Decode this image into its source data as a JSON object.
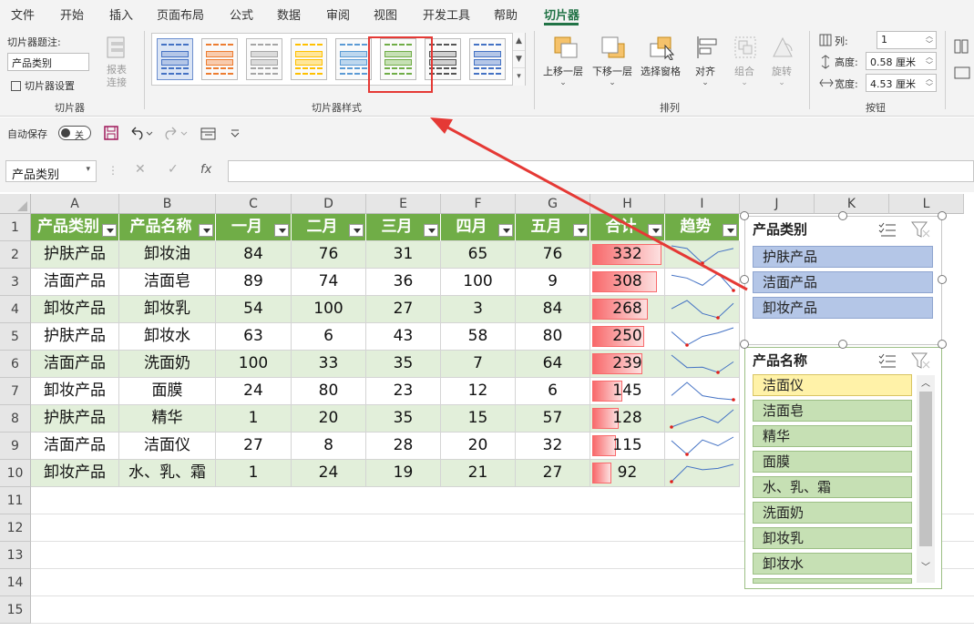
{
  "menu": [
    "文件",
    "开始",
    "插入",
    "页面布局",
    "公式",
    "数据",
    "审阅",
    "视图",
    "开发工具",
    "帮助",
    "切片器"
  ],
  "ribbon": {
    "caption_label": "切片器题注:",
    "caption_value": "产品类别",
    "settings_label": "切片器设置",
    "report_label": "报表",
    "connect_label": "连接",
    "group_slicer": "切片器",
    "group_styles": "切片器样式",
    "group_arrange": "排列",
    "group_buttons": "按钮",
    "bring_forward": "上移一层",
    "send_backward": "下移一层",
    "selection_pane": "选择窗格",
    "align": "对齐",
    "group": "组合",
    "rotate": "旋转",
    "columns_label": "列:",
    "columns_value": "1",
    "height_label": "高度:",
    "height_value": "0.58 厘米",
    "width_label": "宽度:",
    "width_value": "4.53 厘米"
  },
  "qat": {
    "autosave_label": "自动保存",
    "toggle_text": "关"
  },
  "formula_bar": {
    "name_box": "产品类别",
    "fx": "fx"
  },
  "columns": [
    "A",
    "B",
    "C",
    "D",
    "E",
    "F",
    "G",
    "H",
    "I",
    "J",
    "K",
    "L"
  ],
  "rows": [
    "1",
    "2",
    "3",
    "4",
    "5",
    "6",
    "7",
    "8",
    "9",
    "10",
    "11",
    "12",
    "13",
    "14",
    "15"
  ],
  "table": {
    "headers": [
      "产品类别",
      "产品名称",
      "一月",
      "二月",
      "三月",
      "四月",
      "五月",
      "合计",
      "趋势"
    ],
    "rows": [
      [
        "护肤产品",
        "卸妆油",
        "84",
        "76",
        "31",
        "65",
        "76",
        "332"
      ],
      [
        "洁面产品",
        "洁面皂",
        "89",
        "74",
        "36",
        "100",
        "9",
        "308"
      ],
      [
        "卸妆产品",
        "卸妆乳",
        "54",
        "100",
        "27",
        "3",
        "84",
        "268"
      ],
      [
        "护肤产品",
        "卸妆水",
        "63",
        "6",
        "43",
        "58",
        "80",
        "250"
      ],
      [
        "洁面产品",
        "洗面奶",
        "100",
        "33",
        "35",
        "7",
        "64",
        "239"
      ],
      [
        "卸妆产品",
        "面膜",
        "24",
        "80",
        "23",
        "12",
        "6",
        "145"
      ],
      [
        "护肤产品",
        "精华",
        "1",
        "20",
        "35",
        "15",
        "57",
        "128"
      ],
      [
        "洁面产品",
        "洁面仪",
        "27",
        "8",
        "28",
        "20",
        "32",
        "115"
      ],
      [
        "卸妆产品",
        "水、乳、霜",
        "1",
        "24",
        "19",
        "21",
        "27",
        "92"
      ]
    ],
    "total_max": 332
  },
  "slicer1": {
    "title": "产品类别",
    "items": [
      "护肤产品",
      "洁面产品",
      "卸妆产品"
    ]
  },
  "slicer2": {
    "title": "产品名称",
    "items": [
      "洁面仪",
      "洁面皂",
      "精华",
      "面膜",
      "水、乳、霜",
      "洗面奶",
      "卸妆乳",
      "卸妆水"
    ]
  },
  "colors": {
    "header_green": "#70ad47",
    "band_green": "#e2efda",
    "databar_red": "#f8696b",
    "accent": "#217346",
    "annotation": "#e53935"
  }
}
